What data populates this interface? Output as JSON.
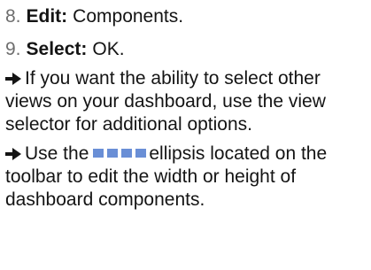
{
  "steps": [
    {
      "number": "8.",
      "action": "Edit:",
      "text": "Components."
    },
    {
      "number": "9.",
      "action": "Select:",
      "text": "OK."
    }
  ],
  "notes": [
    {
      "text": "If you want the ability to select other views on your dashboard, use the view selector for additional options."
    },
    {
      "text_before": "Use the",
      "text_after": "ellipsis located on the toolbar to edit the width or height of dashboard components."
    }
  ],
  "icons": {
    "arrow": "right-arrow-icon",
    "ellipsis": "ellipsis-icon"
  },
  "colors": {
    "text": "#141414",
    "step_number": "#6e6e6e",
    "ellipsis_dots": "#6a8fd6"
  }
}
